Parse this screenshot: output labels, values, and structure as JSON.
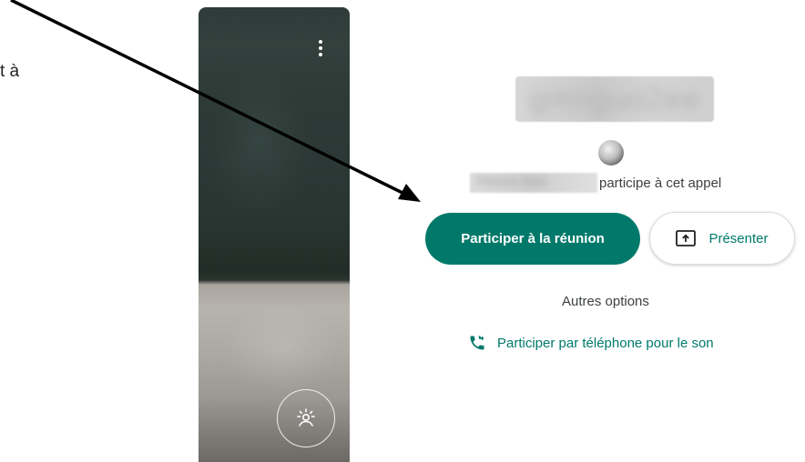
{
  "annotation": {
    "partial_text": "t à"
  },
  "preview": {
    "more_icon": "more-vert-icon",
    "effects_icon": "visual-effects-icon"
  },
  "meeting": {
    "name_blurred": "gmnguo2ee",
    "participant_blurred": "Prénom Nom",
    "participants_text": "participe à cet appel"
  },
  "actions": {
    "join_label": "Participer à la réunion",
    "present_label": "Présenter",
    "other_options_label": "Autres options",
    "phone_label": "Participer par téléphone pour le son"
  },
  "colors": {
    "accent": "#00796b",
    "text": "#3c4043"
  }
}
